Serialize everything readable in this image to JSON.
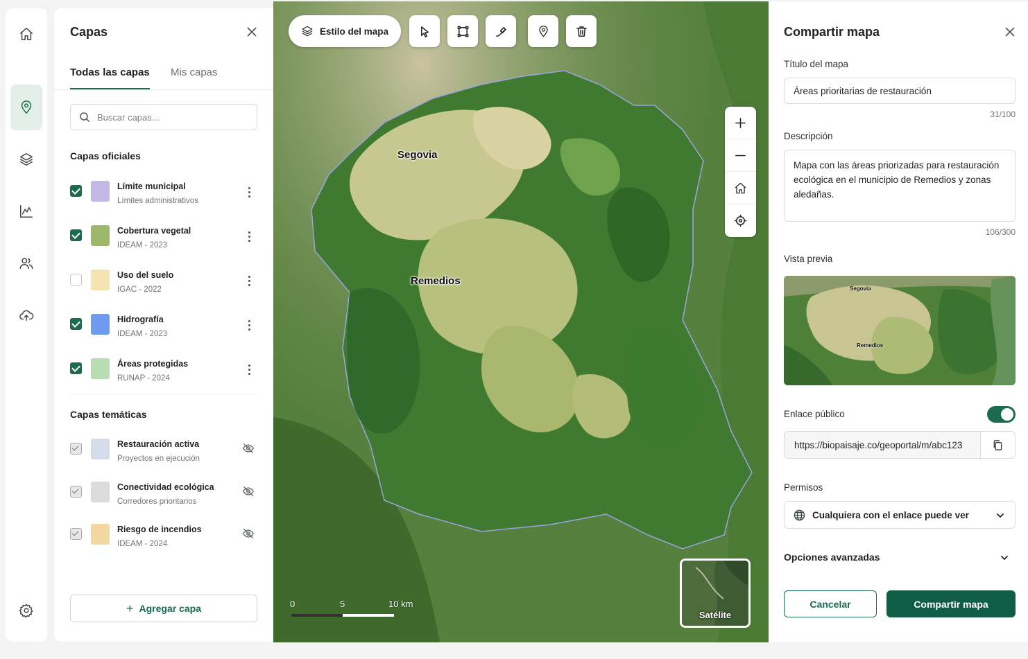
{
  "layers_panel": {
    "title": "Capas",
    "tabs": [
      {
        "label": "Todas las capas",
        "active": true
      },
      {
        "label": "Mis capas",
        "active": false
      }
    ],
    "search_placeholder": "Buscar capas...",
    "official_title": "Capas oficiales",
    "official": [
      {
        "name": "Límite municipal",
        "source": "Límites administrativos",
        "checked": true,
        "color": "#c3b8e6"
      },
      {
        "name": "Cobertura vegetal",
        "source": "IDEAM - 2023",
        "checked": true,
        "color": "#9db86a"
      },
      {
        "name": "Uso del suelo",
        "source": "IGAC - 2022",
        "checked": false,
        "color": "#f3e4b0"
      },
      {
        "name": "Hidrografía",
        "source": "IDEAM - 2023",
        "checked": true,
        "color": "#6d9cf0"
      },
      {
        "name": "Áreas protegidas",
        "source": "RUNAP - 2024",
        "checked": true,
        "color": "#b8ddb0"
      }
    ],
    "thematic_title": "Capas temáticas",
    "thematic": [
      {
        "name": "Restauración activa",
        "source": "Proyectos en ejecución",
        "color": "#d5dcea"
      },
      {
        "name": "Conectividad ecológica",
        "source": "Corredores prioritarios",
        "color": "#dcdcdc"
      },
      {
        "name": "Riesgo de incendios",
        "source": "IDEAM - 2024",
        "color": "#f3d8a0"
      }
    ],
    "add_label": "Agregar capa"
  },
  "map": {
    "style_button": "Estilo del mapa",
    "cities": [
      "Segovia",
      "Remedios"
    ],
    "scale_labels": [
      "0",
      "5",
      "10 km"
    ],
    "basemap_label": "Satélite"
  },
  "share": {
    "title": "Compartir mapa",
    "title_label": "Título del mapa",
    "title_value": "Áreas prioritarias de restauración",
    "title_count": "31/100",
    "desc_label": "Descripción",
    "desc_value": "Mapa con las áreas priorizadas para restauración ecológica en el municipio de Remedios y zonas aledañas.",
    "desc_count": "106/300",
    "preview_label": "Vista previa",
    "preview_cities": [
      "Segovia",
      "Remedios"
    ],
    "public_link_label": "Enlace público",
    "public_link_enabled": true,
    "url": "https://biopaisaje.co/geoportal/m/abc123",
    "permissions_label": "Permisos",
    "permissions_value": "Cualquiera con el enlace puede ver",
    "advanced_label": "Opciones avanzadas",
    "cancel_label": "Cancelar",
    "share_label": "Compartir mapa"
  },
  "colors": {
    "accent": "#1a6b50",
    "primary_button": "#0f5c47"
  }
}
